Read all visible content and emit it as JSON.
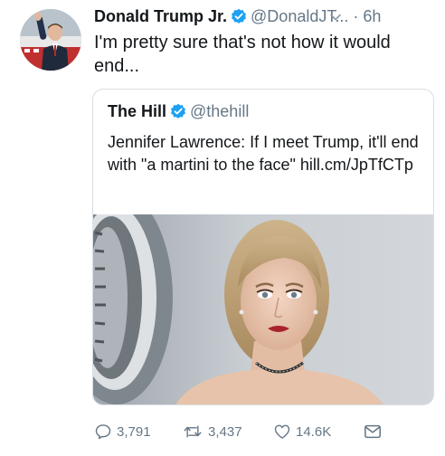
{
  "tweet": {
    "author_name": "Donald Trump Jr.",
    "author_handle": "@DonaldJT...",
    "separator": "·",
    "time": "6h",
    "text": "I'm pretty sure that's not how it would end...",
    "icons": {
      "verified": "verified-badge-icon",
      "menu": "chevron-down-icon"
    }
  },
  "quoted": {
    "author_name": "The Hill",
    "author_handle": "@thehill",
    "text": "Jennifer Lawrence: If I meet Trump, it'll end with \"a martini to the face\" hill.cm/JpTfCTp"
  },
  "actions": {
    "replies": "3,791",
    "retweets": "3,437",
    "likes": "14.6K"
  },
  "colors": {
    "verified": "#1da1f2",
    "secondary_text": "#657786",
    "border": "#d8dee3"
  }
}
